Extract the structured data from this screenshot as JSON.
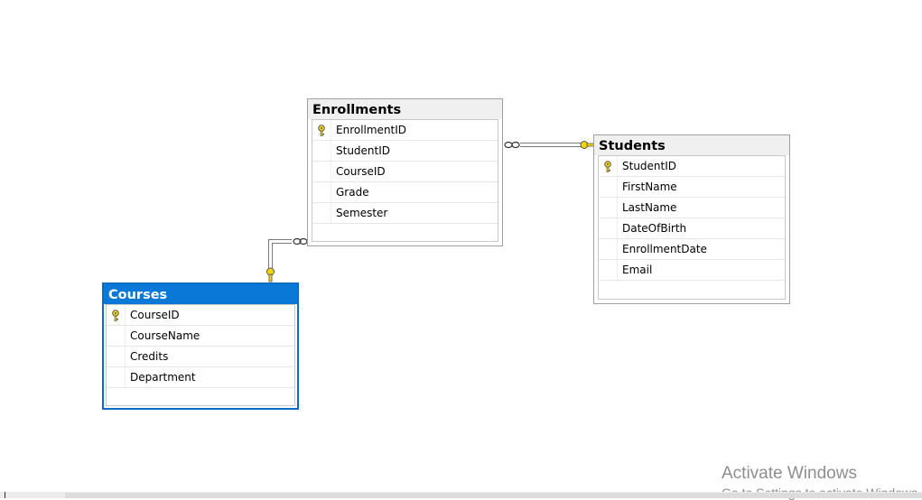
{
  "diagram": {
    "tables": [
      {
        "name": "Enrollments",
        "selected": false,
        "columns": [
          {
            "name": "EnrollmentID",
            "primary_key": true
          },
          {
            "name": "StudentID",
            "primary_key": false
          },
          {
            "name": "CourseID",
            "primary_key": false
          },
          {
            "name": "Grade",
            "primary_key": false
          },
          {
            "name": "Semester",
            "primary_key": false
          }
        ]
      },
      {
        "name": "Students",
        "selected": false,
        "columns": [
          {
            "name": "StudentID",
            "primary_key": true
          },
          {
            "name": "FirstName",
            "primary_key": false
          },
          {
            "name": "LastName",
            "primary_key": false
          },
          {
            "name": "DateOfBirth",
            "primary_key": false
          },
          {
            "name": "EnrollmentDate",
            "primary_key": false
          },
          {
            "name": "Email",
            "primary_key": false
          }
        ]
      },
      {
        "name": "Courses",
        "selected": true,
        "columns": [
          {
            "name": "CourseID",
            "primary_key": true
          },
          {
            "name": "CourseName",
            "primary_key": false
          },
          {
            "name": "Credits",
            "primary_key": false
          },
          {
            "name": "Department",
            "primary_key": false
          }
        ]
      }
    ],
    "relationships": [
      {
        "from": "Enrollments",
        "to": "Students",
        "many_end": "Enrollments",
        "one_end": "Students"
      },
      {
        "from": "Enrollments",
        "to": "Courses",
        "many_end": "Enrollments",
        "one_end": "Courses"
      }
    ],
    "colors": {
      "selected_header": "#0a78d7",
      "header": "#f0f0f0",
      "key_icon": "#f2d40c",
      "line": "#808080"
    }
  },
  "watermark": {
    "line1": "Activate Windows",
    "line2": "Go to Settings to activate Windows."
  }
}
